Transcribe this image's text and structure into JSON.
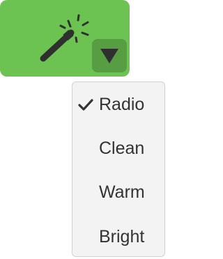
{
  "filter_button": {
    "icon": "magic-wand-icon",
    "dropdown_icon": "caret-down-icon",
    "color": "#6cc352",
    "toggle_color": "#579e42"
  },
  "menu": {
    "selected": "Radio",
    "check_icon": "checkmark-icon",
    "items": [
      {
        "label": "Radio",
        "checked": true
      },
      {
        "label": "Clean",
        "checked": false
      },
      {
        "label": "Warm",
        "checked": false
      },
      {
        "label": "Bright",
        "checked": false
      }
    ]
  }
}
